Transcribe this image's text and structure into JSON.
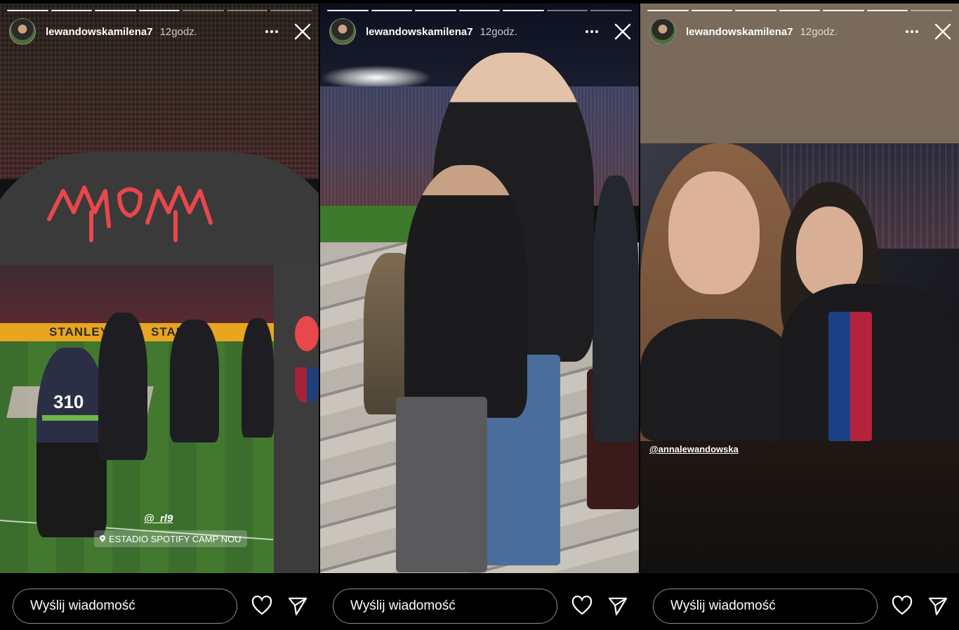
{
  "stories": [
    {
      "username": "lewandowskamilena7",
      "time": "12godz.",
      "progress_total": 7,
      "progress_done": 4,
      "sticker_mention": "@_rl9",
      "location": "ESTADIO SPOTIFY CAMP NOU",
      "adboard": [
        "STANLEY",
        "STANLEY"
      ],
      "bib_number": "310",
      "reply_placeholder": "Wyślij wiadomość"
    },
    {
      "username": "lewandowskamilena7",
      "time": "12godz.",
      "progress_total": 7,
      "progress_done": 5,
      "reply_placeholder": "Wyślij wiadomość"
    },
    {
      "username": "lewandowskamilena7",
      "time": "12godz.",
      "progress_total": 7,
      "progress_done": 6,
      "sticker_mention": "@annalewandowska",
      "reply_placeholder": "Wyślij wiadomość"
    }
  ],
  "icons": {
    "more": "more-options-icon",
    "close": "close-icon",
    "like": "heart-icon",
    "share": "send-icon",
    "location": "location-pin-icon"
  },
  "colors": {
    "background": "#000000",
    "text": "#ffffff"
  }
}
